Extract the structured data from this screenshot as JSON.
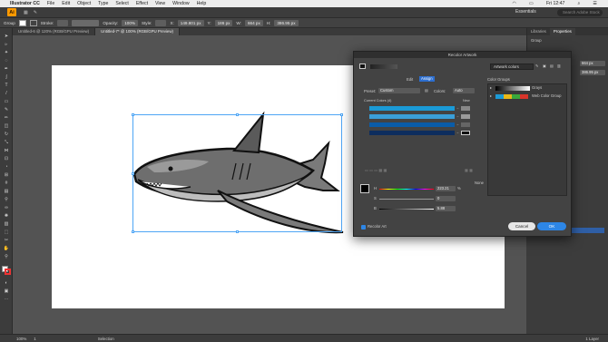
{
  "menubar": {
    "apple": "",
    "app_name": "Illustrator CC",
    "items": [
      "File",
      "Edit",
      "Object",
      "Type",
      "Select",
      "Effect",
      "View",
      "Window",
      "Help"
    ],
    "clock": "Fri 12:47"
  },
  "appbar": {
    "logo": "Ai",
    "workspace": "Essentials",
    "search_placeholder": "Search Adobe Stock"
  },
  "controlbar": {
    "selection_label": "Group",
    "stroke_label": "Stroke:",
    "opacity_label": "Opacity:",
    "opacity_value": "100%",
    "style_label": "Style:",
    "x_label": "X:",
    "x_value": "149.801 px",
    "y_label": "Y:",
    "y_value": "186 px",
    "w_label": "W:",
    "w_value": "664 px",
    "h_label": "H:",
    "h_value": "386.95 px"
  },
  "doc_tabs": [
    "Untitled-6 @ 120% (RGB/GPU Preview)",
    "Untitled-7* @ 100% (RGB/GPU Preview)"
  ],
  "right_panel": {
    "tabs": [
      "Libraries",
      "Properties"
    ],
    "section": "Group",
    "w_value": "664 px",
    "h_value": "386.95 px"
  },
  "statusbar": {
    "zoom": "100%",
    "artboard": "1",
    "tool": "Selection",
    "layers": "1 Layer"
  },
  "dialog": {
    "title": "Recolor Artwork",
    "artwork_colors": "Artwork colors",
    "tab_edit": "Edit",
    "tab_assign": "Assign",
    "preset_label": "Preset:",
    "preset_value": "Custom",
    "colors_label": "Colors:",
    "colors_value": "Auto",
    "current_colors_label": "Current Colors (4)",
    "new_label": "New",
    "color_groups_label": "Color Groups",
    "groups": [
      "Grays",
      "Web Color Group"
    ],
    "none_label": "None",
    "h_label": "H",
    "h_value": "223.21",
    "s_label": "S",
    "s_value": "0",
    "b_label": "B",
    "b_value": "5.88",
    "recolor_art_label": "Recolor Art",
    "cancel": "Cancel",
    "ok": "OK",
    "current_colors": [
      "#1b9ad6",
      "#3a9fd9",
      "#0a5ca8",
      "#0d2d5e"
    ],
    "new_colors": [
      "#888888",
      "#9a9a9a",
      "#666666",
      "#111111"
    ]
  },
  "colors": {
    "accent": "#2d86e6",
    "ai_orange": "#ff9a00",
    "canvas_bg": "#535353"
  }
}
